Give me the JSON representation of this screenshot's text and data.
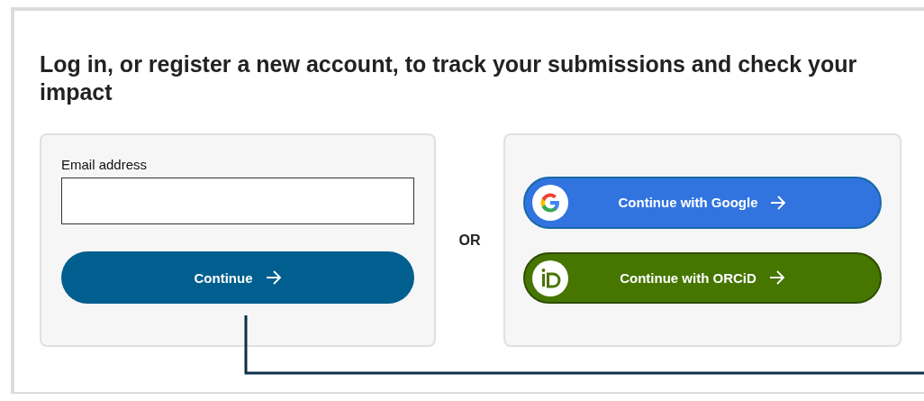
{
  "heading": "Log in, or register a new account, to track your submissions and check your impact",
  "email_form": {
    "label": "Email address",
    "button": "Continue"
  },
  "divider": "OR",
  "providers": [
    {
      "kind": "google",
      "label": "Continue with Google"
    },
    {
      "kind": "orcid",
      "label": "Continue with ORCiD"
    }
  ]
}
